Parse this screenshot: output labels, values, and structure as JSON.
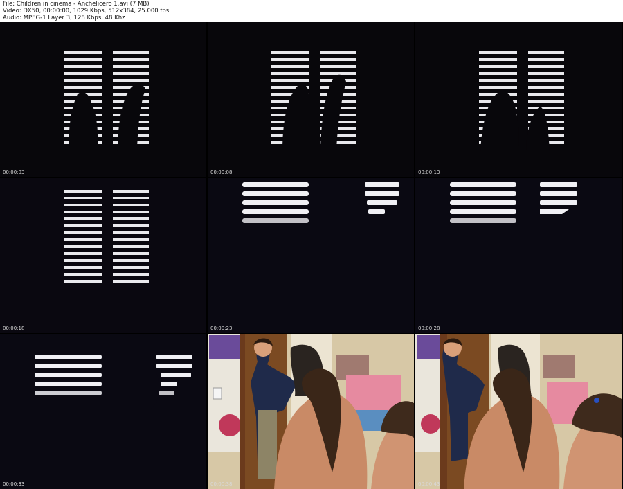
{
  "header": {
    "file": "File: Children in cinema - Anchelicero 1.avi (7 MB)",
    "video": "Video: DX50, 00:00:00, 1029 Kbps, 512x384, 25.000 fps",
    "audio": "Audio: MPEG-1 Layer 3, 128 Kbps, 48 Khz"
  },
  "thumbnails": [
    {
      "time": "00:00:03",
      "scene": "window-blinds-silhouette"
    },
    {
      "time": "00:00:08",
      "scene": "window-blinds-silhouette"
    },
    {
      "time": "00:00:13",
      "scene": "window-blinds-silhouette"
    },
    {
      "time": "00:00:18",
      "scene": "window-blinds"
    },
    {
      "time": "00:00:23",
      "scene": "blinds-closeup"
    },
    {
      "time": "00:00:28",
      "scene": "blinds-closeup"
    },
    {
      "time": "00:00:33",
      "scene": "blinds-closeup"
    },
    {
      "time": "00:00:38",
      "scene": "bedroom-children"
    },
    {
      "time": "00:00:43",
      "scene": "bedroom-children"
    }
  ]
}
